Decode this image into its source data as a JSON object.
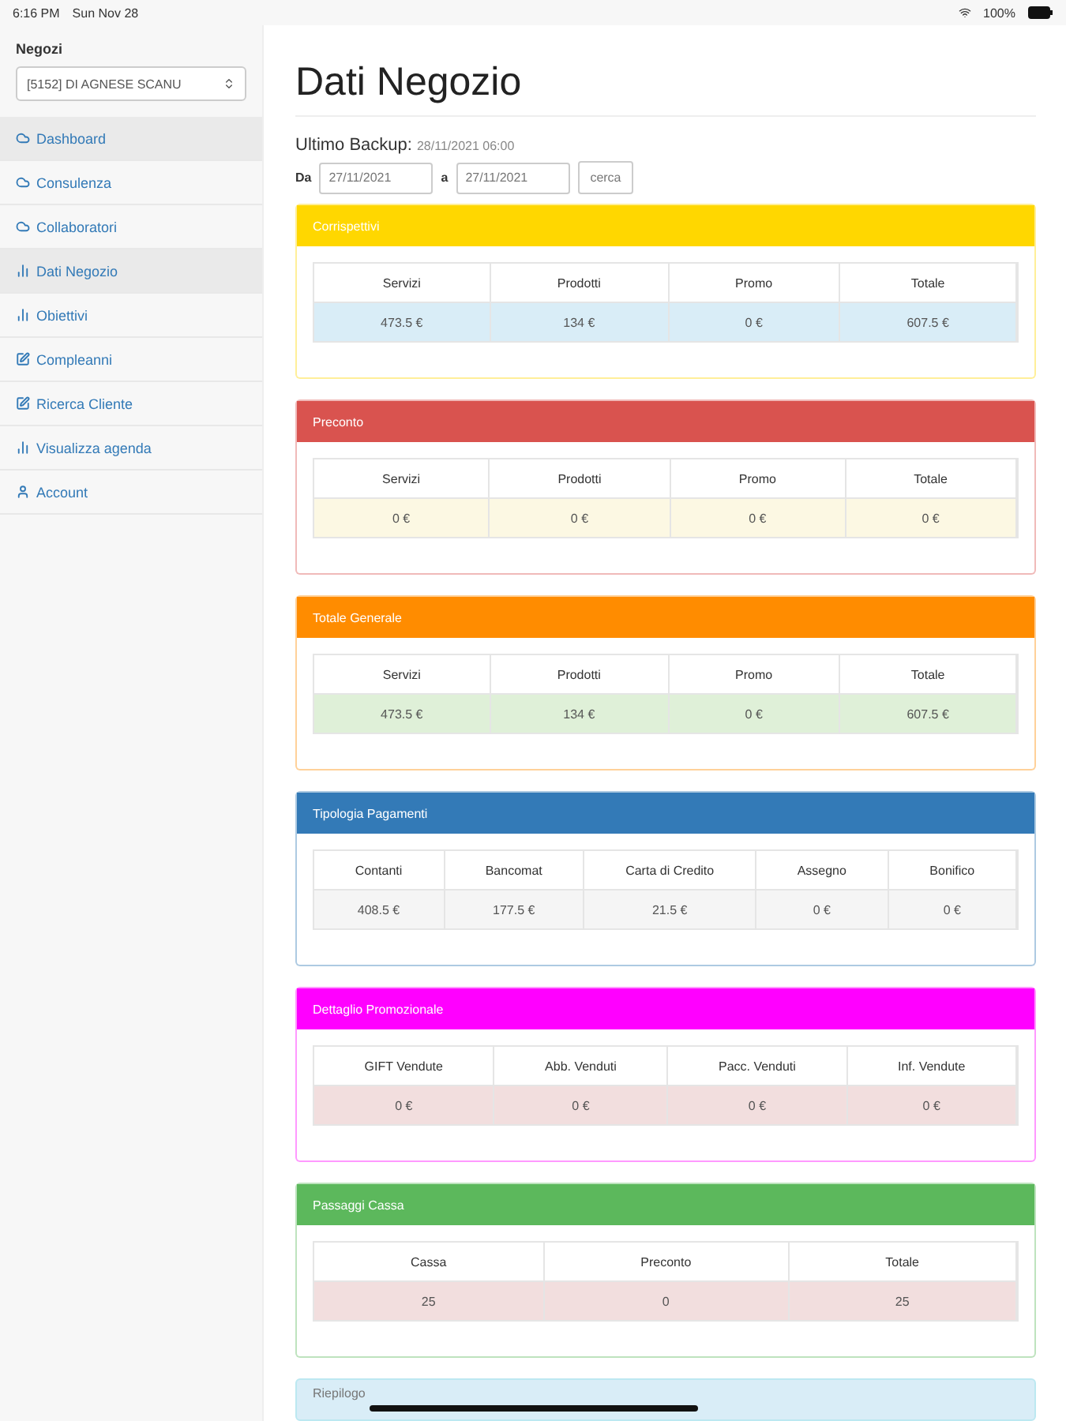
{
  "status_bar": {
    "time": "6:16 PM",
    "date": "Sun Nov 28",
    "battery": "100%"
  },
  "sidebar": {
    "label": "Negozi",
    "store_select": "[5152] DI AGNESE SCANU",
    "items": [
      {
        "label": "Dashboard",
        "kind": "cloud",
        "selected": true
      },
      {
        "label": "Consulenza",
        "kind": "cloud",
        "selected": false
      },
      {
        "label": "Collaboratori",
        "kind": "cloud",
        "selected": false
      },
      {
        "label": "Dati Negozio",
        "kind": "chart",
        "selected": true
      },
      {
        "label": "Obiettivi",
        "kind": "chart",
        "selected": false
      },
      {
        "label": "Compleanni",
        "kind": "edit",
        "selected": false
      },
      {
        "label": "Ricerca Cliente",
        "kind": "edit",
        "selected": false
      },
      {
        "label": "Visualizza agenda",
        "kind": "chart",
        "selected": false
      },
      {
        "label": "Account",
        "kind": "user",
        "selected": false
      }
    ]
  },
  "page": {
    "title": "Dati Negozio",
    "backup_label": "Ultimo Backup:",
    "backup_value": "28/11/2021 06:00",
    "from_label": "Da",
    "from_value": "27/11/2021",
    "to_label": "a",
    "to_value": "27/11/2021",
    "search_button": "cerca"
  },
  "panels": [
    {
      "title": "Corrispettivi",
      "color": "#ffd700",
      "kind": "info",
      "columns": [
        "Servizi",
        "Prodotti",
        "Promo",
        "Totale"
      ],
      "values": [
        "473.5 €",
        "134 €",
        "0 €",
        "607.5 €"
      ]
    },
    {
      "title": "Preconto",
      "color": "#d9534f",
      "kind": "warning",
      "columns": [
        "Servizi",
        "Prodotti",
        "Promo",
        "Totale"
      ],
      "values": [
        "0 €",
        "0 €",
        "0 €",
        "0 €"
      ]
    },
    {
      "title": "Totale Generale",
      "color": "#ff8c00",
      "kind": "success",
      "columns": [
        "Servizi",
        "Prodotti",
        "Promo",
        "Totale"
      ],
      "values": [
        "473.5 €",
        "134 €",
        "0 €",
        "607.5 €"
      ]
    },
    {
      "title": "Tipologia Pagamenti",
      "color": "#337ab7",
      "kind": "active",
      "columns": [
        "Contanti",
        "Bancomat",
        "Carta di Credito",
        "Assegno",
        "Bonifico"
      ],
      "values": [
        "408.5 €",
        "177.5 €",
        "21.5 €",
        "0 €",
        "0 €"
      ]
    },
    {
      "title": "Dettaglio Promozionale",
      "color": "#ff00ff",
      "kind": "danger",
      "columns": [
        "GIFT Vendute",
        "Abb. Venduti",
        "Pacc. Venduti",
        "Inf. Vendute"
      ],
      "values": [
        "0 €",
        "0 €",
        "0 €",
        "0 €"
      ]
    },
    {
      "title": "Passaggi Cassa",
      "color": "#5cb85c",
      "kind": "danger",
      "columns": [
        "Cassa",
        "Preconto",
        "Totale"
      ],
      "values": [
        "25",
        "0",
        "25"
      ]
    }
  ],
  "last_panel": {
    "title": "Riepilogo"
  }
}
